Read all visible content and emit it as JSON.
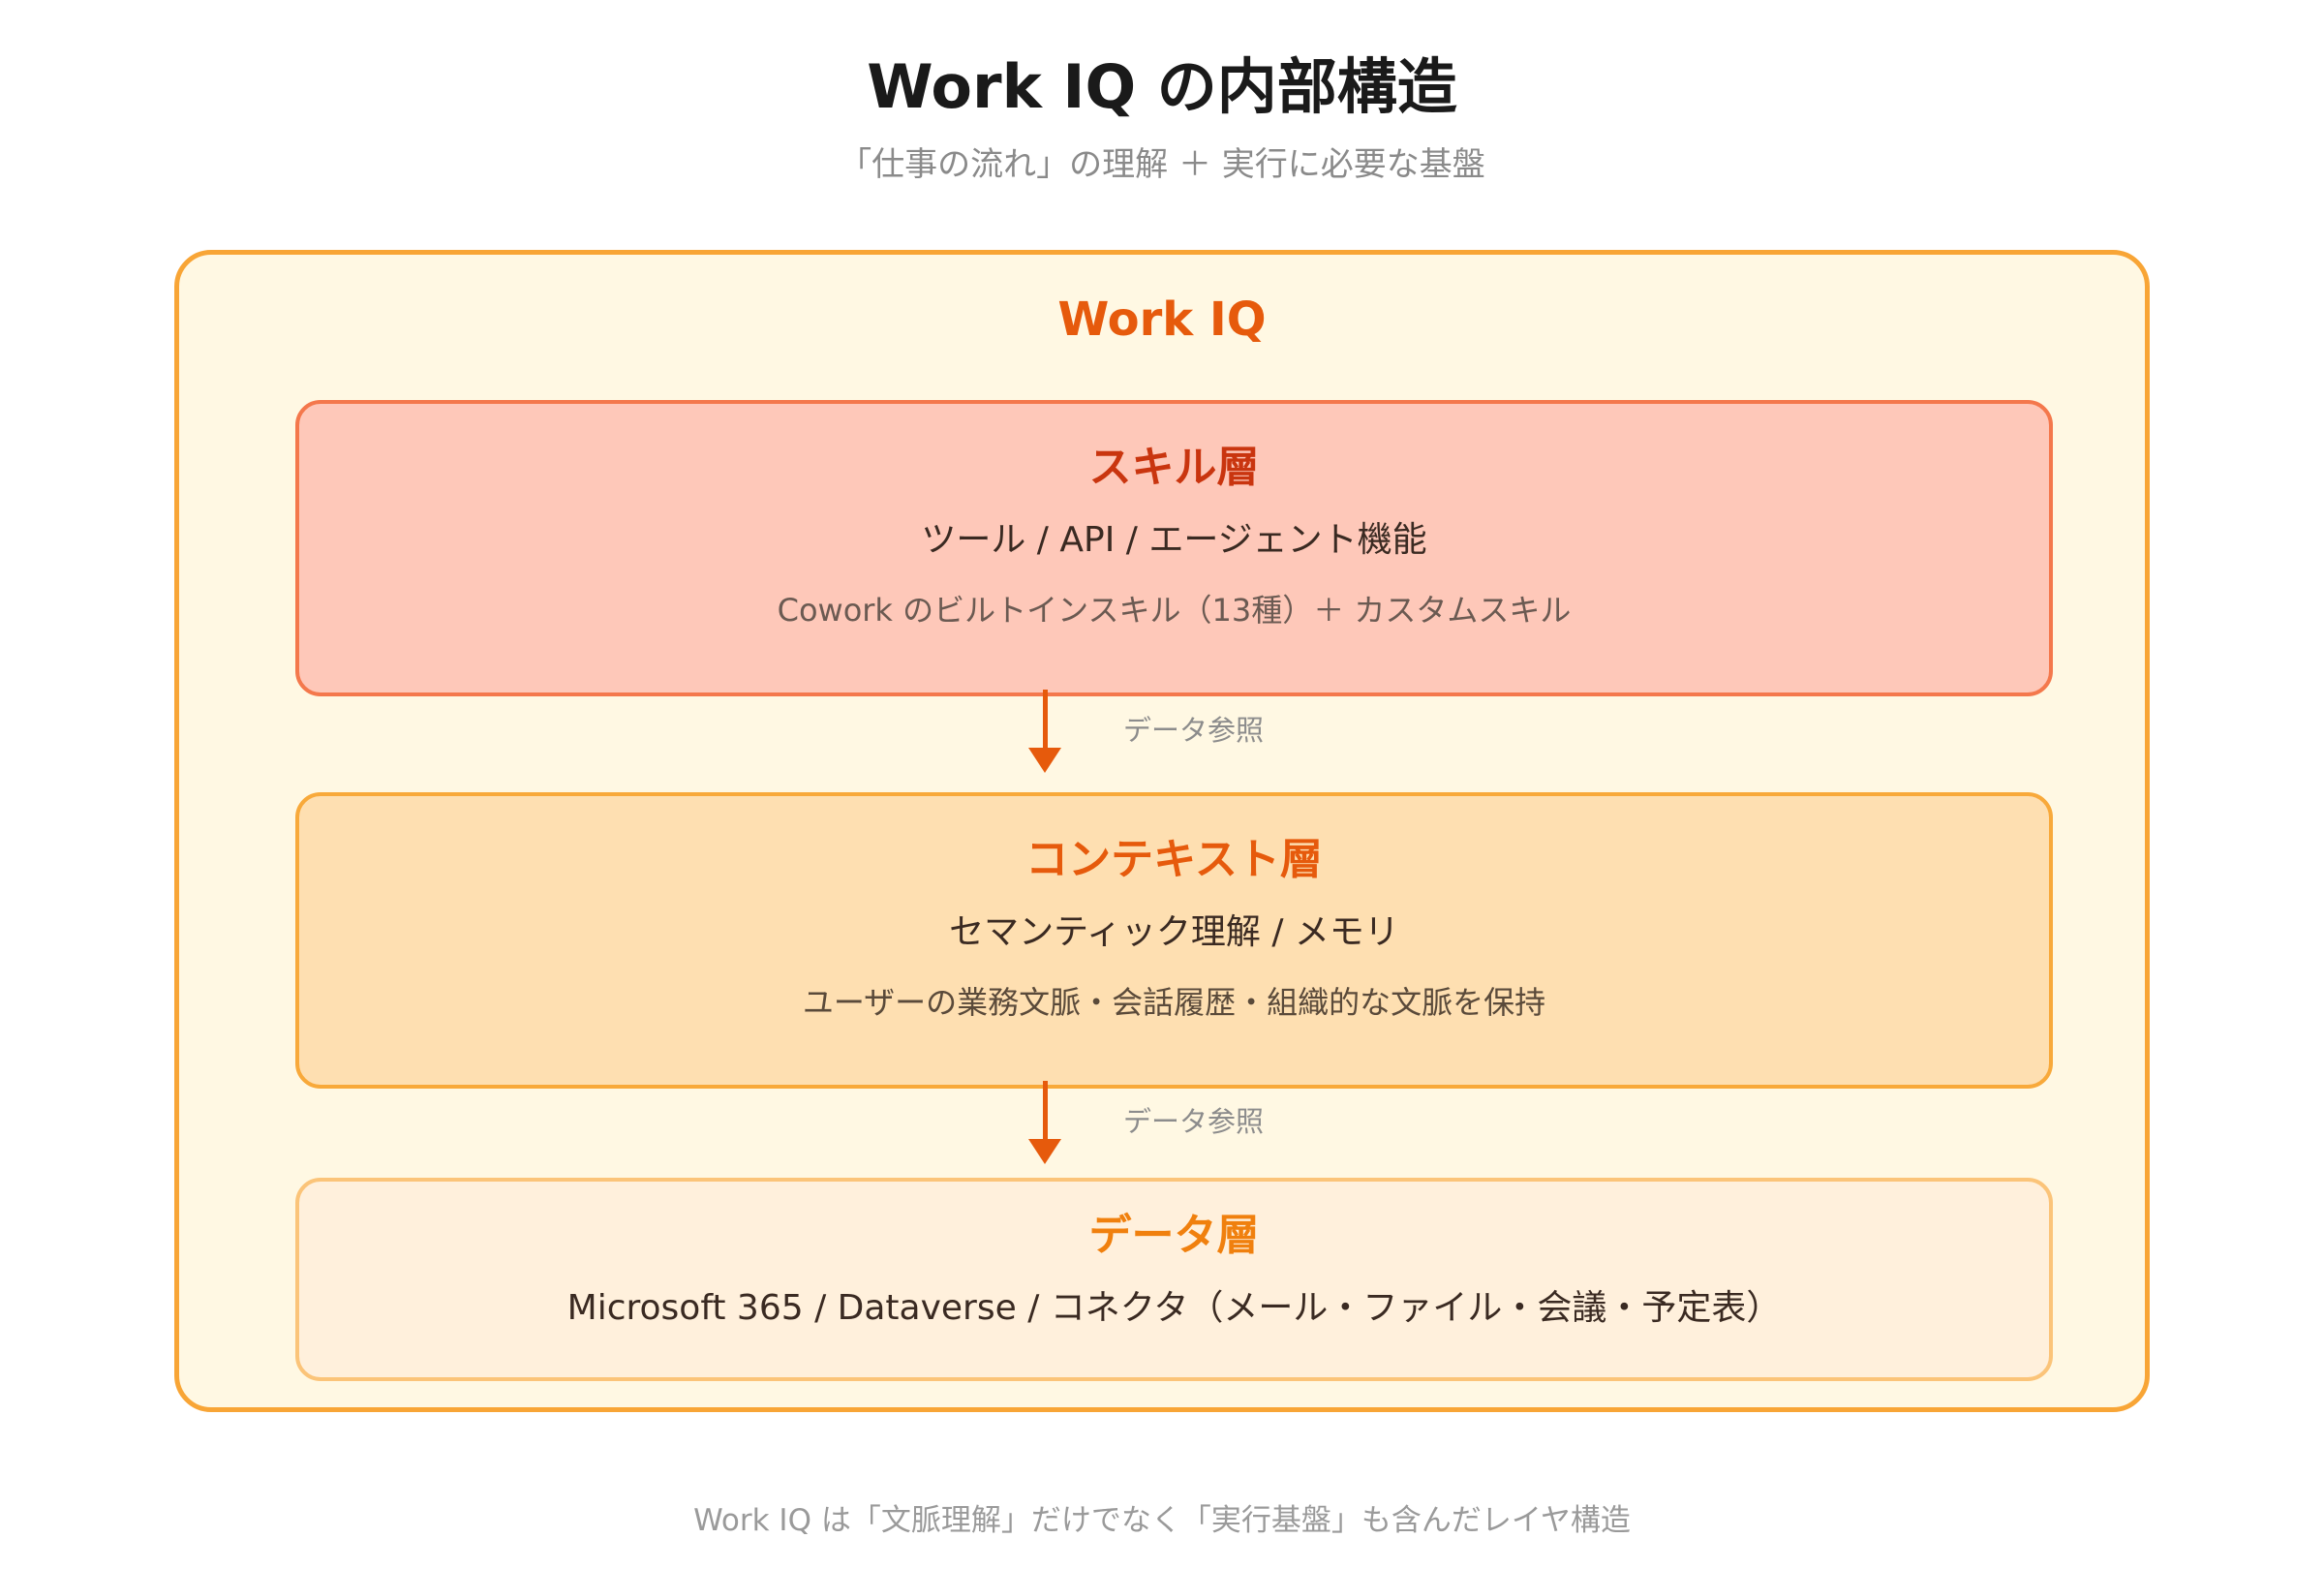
{
  "title": "Work IQ の内部構造",
  "subtitle": "「仕事の流れ」の理解 ＋ 実行に必要な基盤",
  "container": {
    "title": "Work IQ",
    "color": "#f8a536",
    "fill": "#fff8e3"
  },
  "layers": [
    {
      "title": "スキル層",
      "main": "ツール / API / エージェント機能",
      "desc": "Cowork のビルトインスキル（13種）＋ カスタムスキル",
      "color": "#c9350f",
      "fill": "#fec8b9"
    },
    {
      "title": "コンテキスト層",
      "main": "セマンティック理解 / メモリ",
      "desc": "ユーザーの業務文脈・会話履歴・組織的な文脈を保持",
      "color": "#e65a0c",
      "fill": "#fedfb1"
    },
    {
      "title": "データ層",
      "main": "Microsoft 365 / Dataverse / コネクタ（メール・ファイル・会議・予定表）",
      "color": "#f0800e",
      "fill": "#fff0dc"
    }
  ],
  "arrows": [
    {
      "label": "データ参照"
    },
    {
      "label": "データ参照"
    }
  ],
  "footer": "Work IQ は「文脈理解」だけでなく「実行基盤」も含んだレイヤ構造"
}
